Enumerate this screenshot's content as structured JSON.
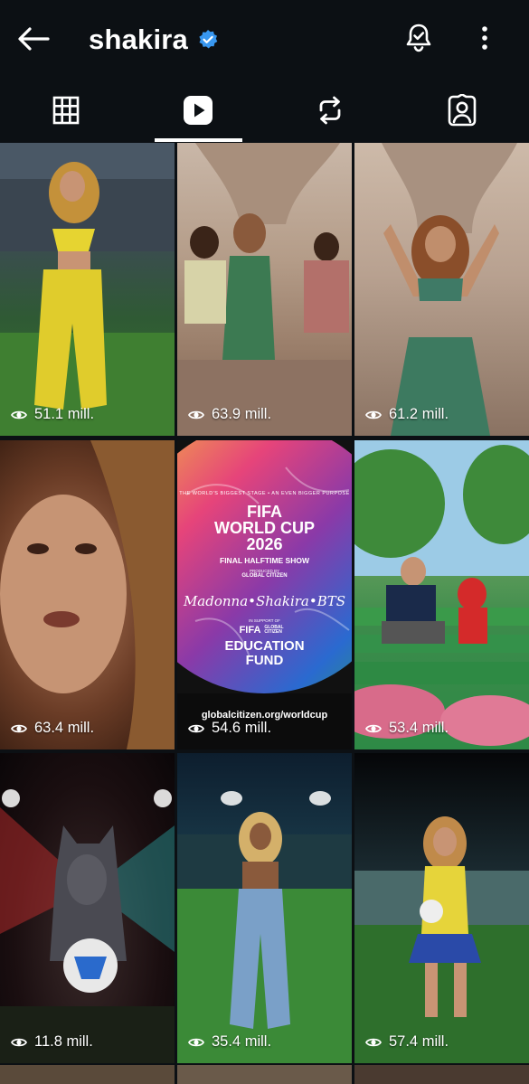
{
  "header": {
    "title": "shakira",
    "back_icon": "arrow-left-icon",
    "verified_icon": "verified-badge-icon",
    "verified_color": "#3897f0",
    "notifications_icon": "bell-icon",
    "more_icon": "more-vertical-icon"
  },
  "tabs": [
    {
      "name": "posts",
      "icon": "grid-icon",
      "selected": false
    },
    {
      "name": "reels",
      "icon": "reels-play-icon",
      "selected": true
    },
    {
      "name": "reposts",
      "icon": "repost-icon",
      "selected": false
    },
    {
      "name": "tagged",
      "icon": "tagged-person-icon",
      "selected": false
    }
  ],
  "reels": [
    {
      "views": "51.1 mill."
    },
    {
      "views": "63.9 mill."
    },
    {
      "views": "61.2 mill."
    },
    {
      "views": "63.4 mill."
    },
    {
      "views": "54.6 mill.",
      "overlay": {
        "kicker": "THE WORLD'S BIGGEST STAGE  •  AN EVEN BIGGER PURPOSE",
        "line1": "FIFA",
        "line2": "WORLD CUP",
        "line3": "2026",
        "line4": "FINAL HALFTIME SHOW",
        "produced_by": "PRODUCED BY",
        "producer": "GLOBAL CITIZEN",
        "artists": "Madonna•Shakira•BTS",
        "support": "IN SUPPORT OF",
        "fifa_logo": "FIFA",
        "gc_logo": "GLOBAL CITIZEN",
        "fund1": "EDUCATION",
        "fund2": "FUND",
        "url": "globalcitizen.org/worldcup"
      }
    },
    {
      "views": "53.4 mill."
    },
    {
      "views": "11.8 mill."
    },
    {
      "views": "35.4 mill."
    },
    {
      "views": "57.4 mill."
    }
  ]
}
